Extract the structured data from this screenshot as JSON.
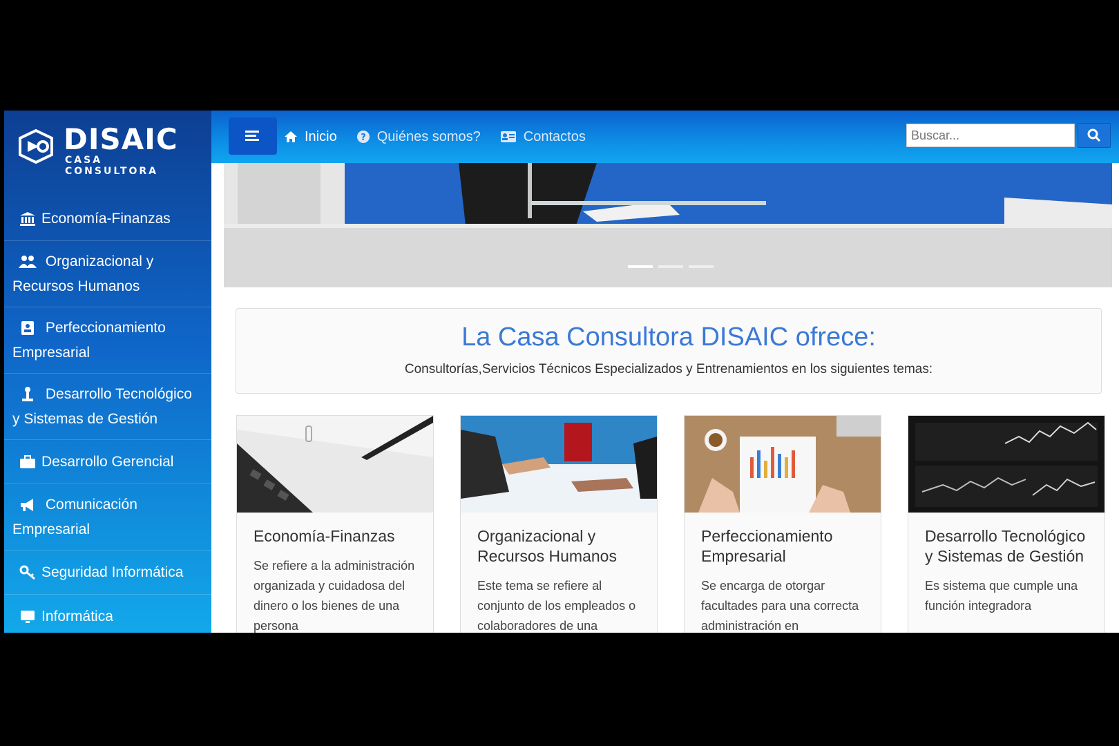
{
  "brand": {
    "name": "DISAIC",
    "subtitle": "CASA CONSULTORA"
  },
  "colors": {
    "accent": "#3a79d6",
    "header": "#0d8ee6",
    "sidebar_top": "#0d3f93",
    "sidebar_bottom": "#12a8ea"
  },
  "sidebar": {
    "items": [
      {
        "label": "Economía-Finanzas",
        "icon": "bank-icon"
      },
      {
        "label": "Organizacional y Recursos Humanos",
        "icon": "users-icon"
      },
      {
        "label": "Perfeccionamiento Empresarial",
        "icon": "id-card-icon"
      },
      {
        "label": "Desarrollo Tecnológico y Sistemas de Gestión",
        "icon": "lamp-icon"
      },
      {
        "label": "Desarrollo Gerencial",
        "icon": "briefcase-icon"
      },
      {
        "label": "Comunicación Empresarial",
        "icon": "bullhorn-icon"
      },
      {
        "label": "Seguridad Informática",
        "icon": "key-icon"
      },
      {
        "label": "Informática",
        "icon": "monitor-icon"
      }
    ]
  },
  "header": {
    "nav": [
      {
        "label": "Inicio",
        "icon": "home-icon"
      },
      {
        "label": "Quiénes somos?",
        "icon": "question-circle-icon"
      },
      {
        "label": "Contactos",
        "icon": "contact-card-icon"
      }
    ],
    "search": {
      "placeholder": "Buscar...",
      "icon": "search-icon"
    }
  },
  "intro": {
    "title": "La Casa Consultora DISAIC ofrece:",
    "subtitle": "Consultorías,Servicios Técnicos Especializados y Entrenamientos en los siguientes temas:"
  },
  "cards": [
    {
      "title": "Economía-Finanzas",
      "text": "Se refiere a la administración organizada y cuidadosa del dinero o los bienes de una persona"
    },
    {
      "title": "Organizacional y Recursos Humanos",
      "text": "Este tema se refiere al conjunto de los empleados o colaboradores de una"
    },
    {
      "title": "Perfeccionamiento Empresarial",
      "text": "Se encarga de otorgar facultades para una correcta administración en"
    },
    {
      "title": "Desarrollo Tecnológico y Sistemas de Gestión",
      "text": "Es sistema que cumple una función integradora"
    }
  ]
}
